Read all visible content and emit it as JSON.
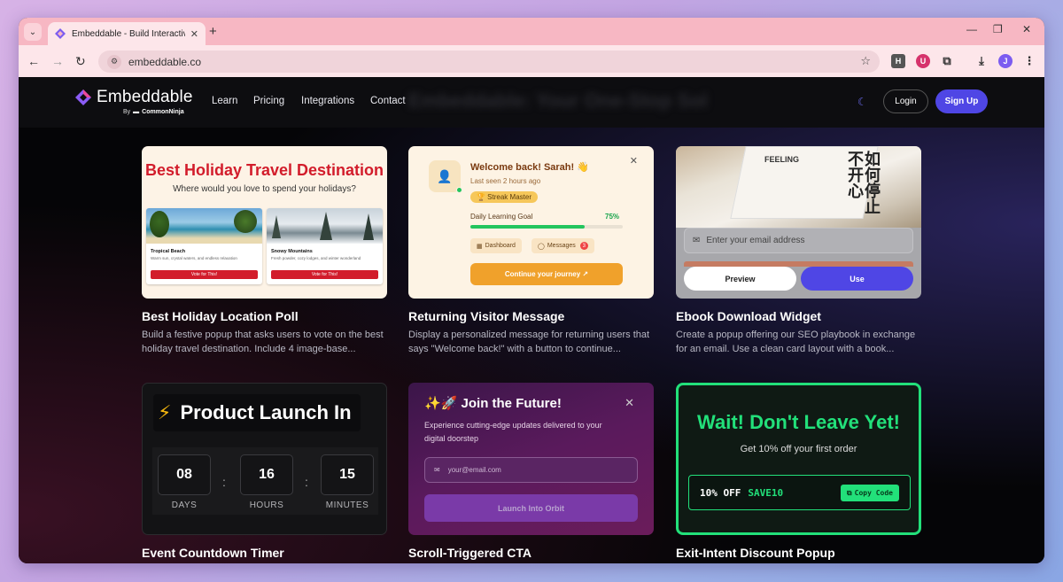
{
  "browser": {
    "tab_title": "Embeddable - Build Interactive",
    "url": "embeddable.co",
    "extension_h": "H",
    "profile_initial": "J"
  },
  "site": {
    "brand": "Embeddable",
    "by": "By",
    "by_brand": "CommonNinja",
    "nav": [
      "Learn",
      "Pricing",
      "Integrations",
      "Contact"
    ],
    "ghost_text": "Embeddable: Your One-Stop Sol",
    "login": "Login",
    "signup": "Sign Up"
  },
  "cards": [
    {
      "title": "Best Holiday Location Poll",
      "desc": "Build a festive popup that asks users to vote on the best holiday travel destination. Include 4 image-base...",
      "preview": {
        "heading": "Best Holiday Travel Destination",
        "sub": "Where would you love to spend your holidays?",
        "options": [
          {
            "name": "Tropical Beach",
            "desc": "Warm sun, crystal waters, and endless relaxation",
            "vote": "Vote for This!"
          },
          {
            "name": "Snowy Mountains",
            "desc": "Fresh powder, cozy lodges, and winter wonderland",
            "vote": "Vote for This!"
          }
        ]
      }
    },
    {
      "title": "Returning Visitor Message",
      "desc": "Display a personalized message for returning users that says \"Welcome back!\" with a button to continue...",
      "preview": {
        "welcome": "Welcome back! Sarah! 👋",
        "last_seen": "Last seen 2 hours ago",
        "badge": "🏆 Streak Master",
        "goal_label": "Daily Learning Goal",
        "goal_pct": "75%",
        "goal_value": 75,
        "chip_dashboard": "Dashboard",
        "chip_messages": "Messages",
        "message_count": "3",
        "cta": "Continue your journey ↗"
      }
    },
    {
      "title": "Ebook Download Widget",
      "desc": "Create a popup offering our SEO playbook in exchange for an email. Use a clean card layout with a book...",
      "preview": {
        "cjk_title": "如何停止不开心",
        "book_en": "FEELING",
        "email_placeholder": "Enter your email address",
        "btn_preview": "Preview",
        "btn_use": "Use"
      }
    },
    {
      "title": "Event Countdown Timer",
      "desc": "",
      "preview": {
        "heading": "Product Launch In",
        "units": [
          {
            "value": "08",
            "label": "DAYS"
          },
          {
            "value": "16",
            "label": "HOURS"
          },
          {
            "value": "15",
            "label": "MINUTES"
          }
        ],
        "sep": ":"
      }
    },
    {
      "title": "Scroll-Triggered CTA",
      "desc": "",
      "preview": {
        "heading": "✨🚀 Join the Future!",
        "sub": "Experience cutting-edge updates delivered to your digital doorstep",
        "placeholder": "your@email.com",
        "button": "Launch Into Orbit"
      }
    },
    {
      "title": "Exit-Intent Discount Popup",
      "desc": "",
      "preview": {
        "heading": "Wait! Don't Leave Yet!",
        "sub": "Get 10% off your first order",
        "off": "10% OFF",
        "code": "SAVE10",
        "copy": "Copy Code"
      }
    }
  ],
  "colors": {
    "accent": "#4f46e5",
    "poll_red": "#d21c2b",
    "orange": "#f0a12b",
    "neon_green": "#22e07a"
  }
}
